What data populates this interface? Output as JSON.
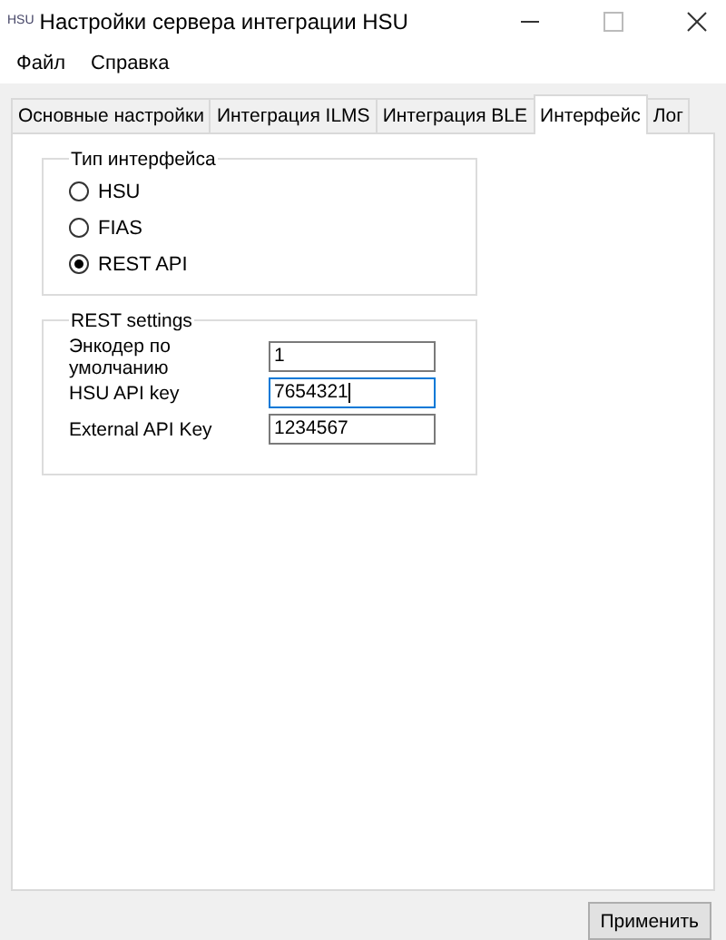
{
  "window": {
    "icon": "HSU",
    "title": "Настройки сервера интеграции HSU"
  },
  "menu": [
    "Файл",
    "Справка"
  ],
  "tabs": [
    {
      "label": "Основные настройки",
      "selected": false
    },
    {
      "label": "Интеграция ILMS",
      "selected": false
    },
    {
      "label": "Интеграция BLE",
      "selected": false
    },
    {
      "label": "Интерфейс",
      "selected": true
    },
    {
      "label": "Лог",
      "selected": false
    }
  ],
  "interface_type": {
    "title": "Тип интерфейса",
    "options": [
      {
        "label": "HSU",
        "selected": false
      },
      {
        "label": "FIAS",
        "selected": false
      },
      {
        "label": "REST API",
        "selected": true
      }
    ]
  },
  "rest_settings": {
    "title": "REST settings",
    "fields": [
      {
        "label": "Энкодер по умолчанию",
        "value": "1",
        "focused": false
      },
      {
        "label": "HSU API key",
        "value": "7654321",
        "focused": true
      },
      {
        "label": "External API Key",
        "value": "1234567",
        "focused": false
      }
    ]
  },
  "apply_button": "Применить"
}
